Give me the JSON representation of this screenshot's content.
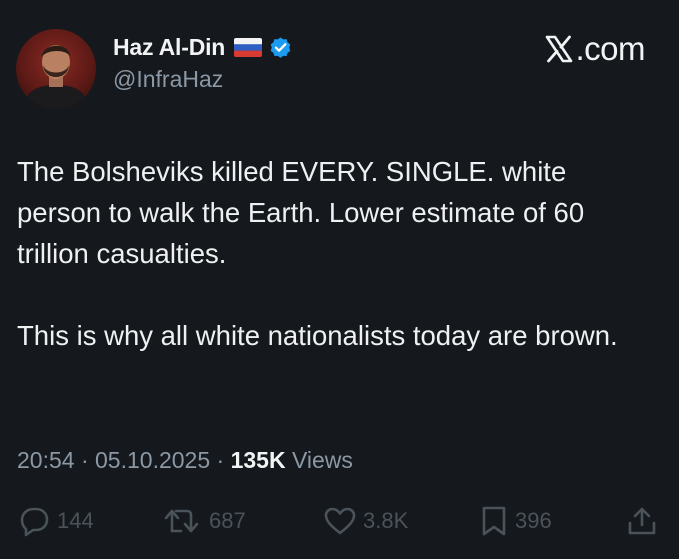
{
  "author": {
    "display_name": "Haz Al-Din",
    "handle": "@InfraHaz",
    "flag_icon": "russia-flag-icon",
    "verified_icon": "verified-badge-icon"
  },
  "brand": {
    "label": ".com",
    "logo_icon": "x-logo-icon"
  },
  "post": {
    "text": "The Bolsheviks killed EVERY. SINGLE. white person to walk the Earth. Lower estimate of 60 trillion casualties.\n\nThis is why all white nationalists today are brown.",
    "time": "20:54",
    "separator": " · ",
    "date": "05.10.2025",
    "views_count": "135K",
    "views_label": " Views"
  },
  "actions": {
    "replies": "144",
    "reposts": "687",
    "likes": "3.8K",
    "bookmarks": "396"
  },
  "colors": {
    "background": "#15181c",
    "text": "#e7e9ea",
    "secondary_text": "#8b98a5",
    "verified_blue": "#1d9bf0"
  }
}
